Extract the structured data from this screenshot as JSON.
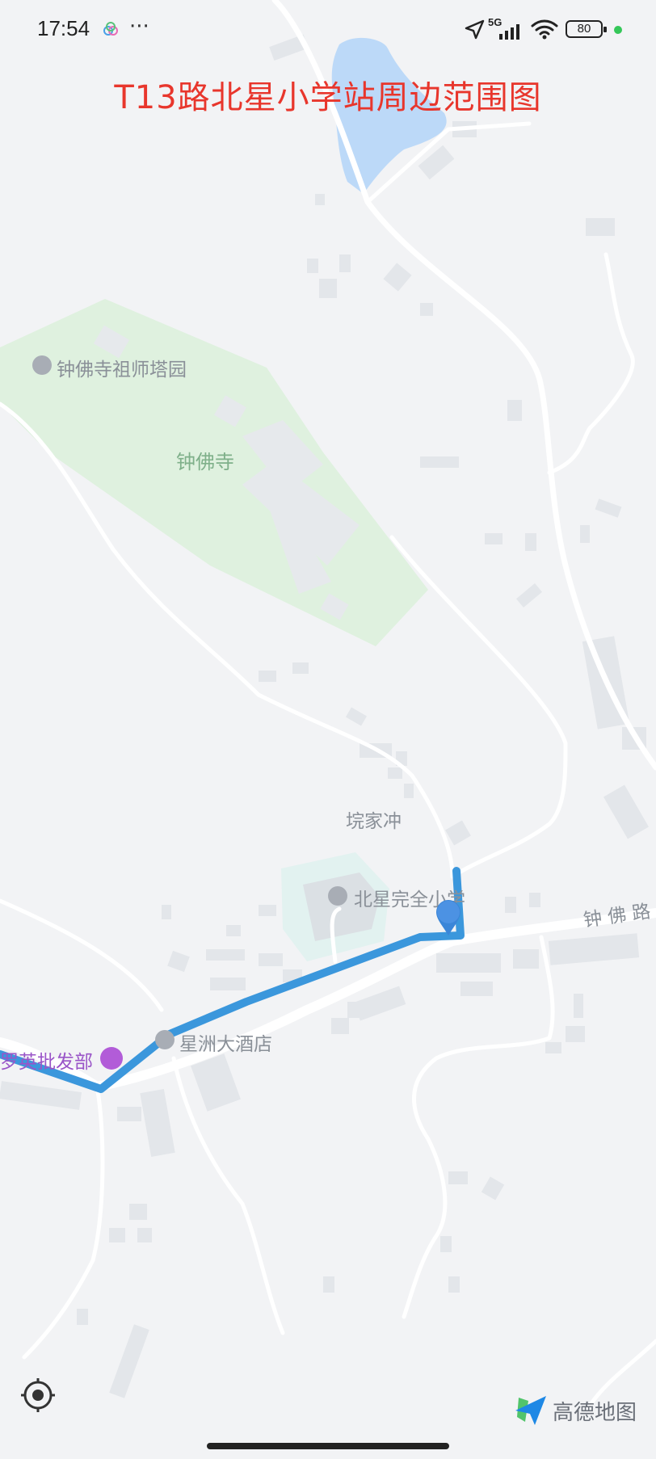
{
  "status_bar": {
    "time": "17:54",
    "more": "···",
    "network": "5G",
    "battery": "80"
  },
  "title": "T13路北星小学站周边范围图",
  "map": {
    "labels": {
      "zhongfo_pagoda": "钟佛寺祖师塔园",
      "zhongfo_temple": "钟佛寺",
      "kengjiachong": "垸家冲",
      "beixing_school": "北星完全小学",
      "zhongfo_road": "钟 佛 路",
      "luoying_store": "罗英批发部",
      "xingzhou_hotel": "星洲大酒店"
    }
  },
  "logo": {
    "text": "高德地图"
  },
  "colors": {
    "title": "#e8362c",
    "route": "#3b97dc",
    "park": "#dff1df",
    "water": "#bcd9f8",
    "road": "#ffffff",
    "background": "#f2f3f5"
  }
}
